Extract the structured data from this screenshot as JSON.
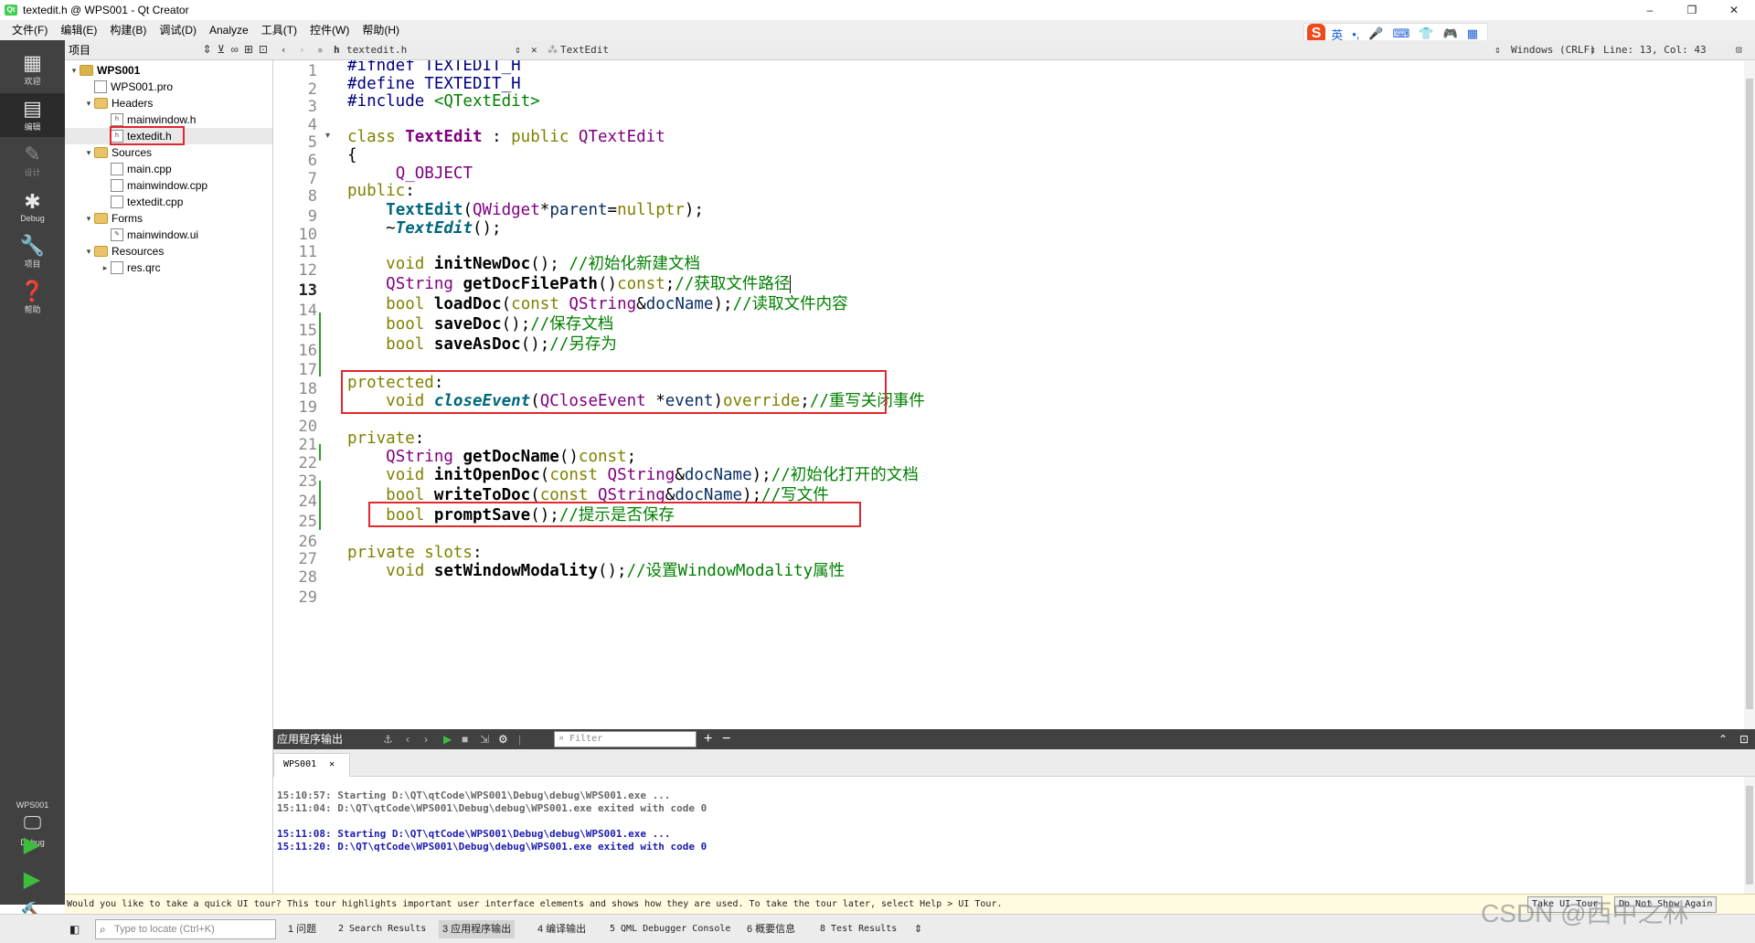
{
  "window": {
    "title": "textedit.h @ WPS001 - Qt Creator",
    "minimize": "–",
    "maximize": "❐",
    "close": "✕"
  },
  "menu": [
    "文件(F)",
    "编辑(E)",
    "构建(B)",
    "调试(D)",
    "Analyze",
    "工具(T)",
    "控件(W)",
    "帮助(H)"
  ],
  "ime": {
    "logo": "S",
    "lang": "英",
    "items": [
      "•,",
      "🎤",
      "⌨",
      "👕",
      "🎮",
      "▦"
    ]
  },
  "modes": [
    {
      "label": "欢迎",
      "icon": "grid-icon"
    },
    {
      "label": "编辑",
      "icon": "edit-doc-icon"
    },
    {
      "label": "设计",
      "icon": "pencil-icon"
    },
    {
      "label": "Debug",
      "icon": "bug-icon"
    },
    {
      "label": "项目",
      "icon": "wrench-icon"
    },
    {
      "label": "帮助",
      "icon": "help-icon"
    }
  ],
  "kit": {
    "project": "WPS001",
    "mode": "Debug"
  },
  "project_pane": {
    "title": "项目",
    "tree": [
      {
        "label": "WPS001",
        "type": "project"
      },
      {
        "label": "WPS001.pro",
        "type": "file"
      },
      {
        "label": "Headers",
        "type": "folder"
      },
      {
        "label": "mainwindow.h",
        "type": "file"
      },
      {
        "label": "textedit.h",
        "type": "file"
      },
      {
        "label": "Sources",
        "type": "folder"
      },
      {
        "label": "main.cpp",
        "type": "file"
      },
      {
        "label": "mainwindow.cpp",
        "type": "file"
      },
      {
        "label": "textedit.cpp",
        "type": "file"
      },
      {
        "label": "Forms",
        "type": "folder"
      },
      {
        "label": "mainwindow.ui",
        "type": "file"
      },
      {
        "label": "Resources",
        "type": "folder"
      },
      {
        "label": "res.qrc",
        "type": "file"
      }
    ]
  },
  "editor_toolbar": {
    "file": "textedit.h",
    "symbol": "TextEdit",
    "line_ending": "Windows (CRLF)",
    "position": "Line: 13, Col: 43"
  },
  "line_numbers": [
    "1",
    "2",
    "3",
    "4",
    "5",
    "6",
    "7",
    "8",
    "9",
    "10",
    "11",
    "12",
    "13",
    "14",
    "15",
    "16",
    "17",
    "18",
    "19",
    "20",
    "21",
    "22",
    "23",
    "24",
    "25",
    "26",
    "27",
    "28",
    "29"
  ],
  "current_line": "13",
  "output": {
    "title": "应用程序输出",
    "filter_placeholder": "Filter",
    "tab": "WPS001",
    "lines": [
      "15:10:57: Starting D:\\QT\\qtCode\\WPS001\\Debug\\debug\\WPS001.exe ...",
      "15:11:04: D:\\QT\\qtCode\\WPS001\\Debug\\debug\\WPS001.exe exited with code 0",
      "15:11:08: Starting D:\\QT\\qtCode\\WPS001\\Debug\\debug\\WPS001.exe ...",
      "15:11:20: D:\\QT\\qtCode\\WPS001\\Debug\\debug\\WPS001.exe exited with code 0"
    ]
  },
  "tour": {
    "message": "Would you like to take a quick UI tour? This tour highlights important user interface elements and shows how they are used. To take the tour later, select Help > UI Tour.",
    "take_button": "Take UI Tour",
    "dismiss_button": "Do Not Show Again"
  },
  "statusbar": {
    "locator_placeholder": "Type to locate (Ctrl+K)",
    "panes": [
      "1 问题",
      "2 Search Results",
      "3 应用程序输出",
      "4 编译输出",
      "5 QML Debugger Console",
      "6 概要信息",
      "8 Test Results"
    ]
  },
  "watermark": "CSDN @西中之林",
  "colors": {
    "highlight_box": "#e0282e",
    "keyword": "#808000",
    "type": "#800080",
    "comment": "#008000"
  }
}
